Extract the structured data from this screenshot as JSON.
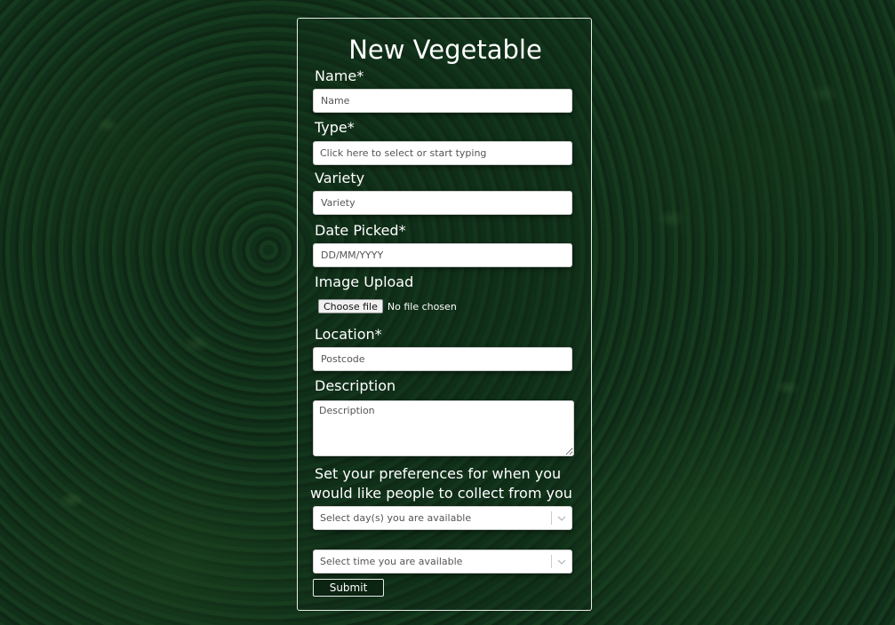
{
  "form": {
    "title": "New Vegetable",
    "name": {
      "label": "Name*",
      "placeholder": "Name"
    },
    "type": {
      "label": "Type*",
      "placeholder": "Click here to select or start typing"
    },
    "variety": {
      "label": "Variety",
      "placeholder": "Variety"
    },
    "date_picked": {
      "label": "Date Picked*",
      "placeholder": "DD/MM/YYYY"
    },
    "image_upload": {
      "label": "Image Upload",
      "button_label": "Choose file",
      "status": "No file chosen"
    },
    "location": {
      "label": "Location*",
      "placeholder": "Postcode"
    },
    "description": {
      "label": "Description",
      "placeholder": "Description"
    },
    "preferences": {
      "line1": "Set your preferences for when you",
      "line2": "would like people to collect from you",
      "days_placeholder": "Select day(s) you are available",
      "time_placeholder": "Select time you are available"
    },
    "submit_label": "Submit"
  }
}
